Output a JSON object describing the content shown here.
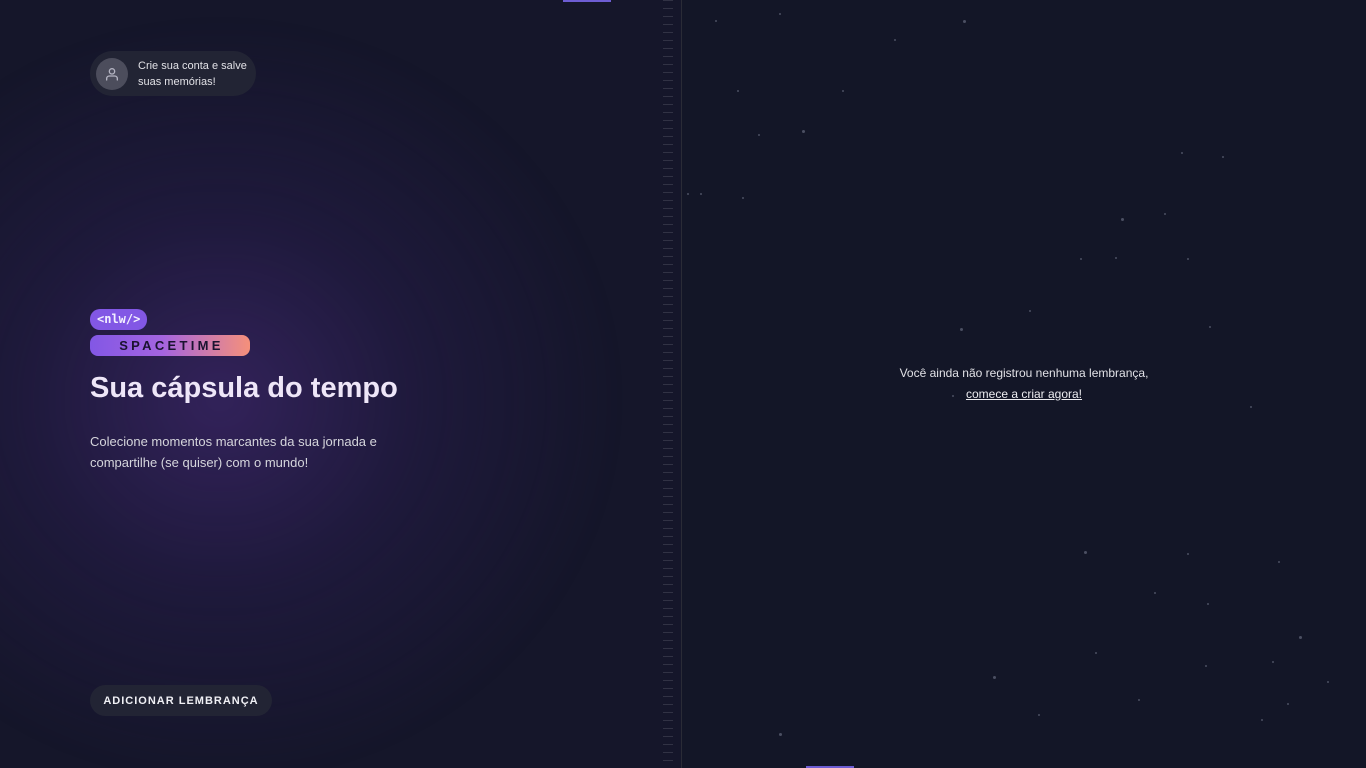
{
  "user": {
    "cta_line": "Crie sua conta e salve suas memórias!"
  },
  "brand": {
    "tag": "<nlw/>",
    "wordmark": "SPACETIME"
  },
  "hero": {
    "title": "Sua cápsula do tempo",
    "description": "Colecione momentos marcantes da sua jornada e compartilhe (se quiser) com o mundo!"
  },
  "actions": {
    "add_memory_label": "ADICIONAR LEMBRANÇA"
  },
  "empty_state": {
    "message": "Você ainda não registrou nenhuma lembrança,",
    "link_text": "comece a criar agora!"
  },
  "colors": {
    "accent": "#8257e5",
    "gradient_end": "#f5907a",
    "panel": "#222434"
  },
  "icons": {
    "avatar": "user-icon"
  }
}
